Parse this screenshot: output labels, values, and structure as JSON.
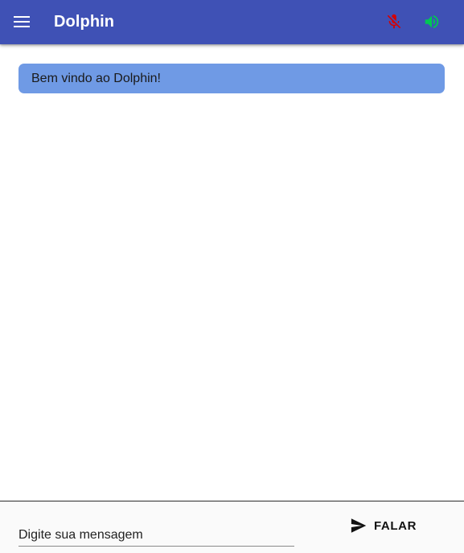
{
  "appbar": {
    "title": "Dolphin",
    "background": "#3f51b5",
    "menu_icon": "menu-icon",
    "mic_icon": "mic-off-icon",
    "mic_color": "#d50000",
    "volume_icon": "volume-up-icon",
    "volume_color": "#00c853"
  },
  "chat": {
    "messages": [
      {
        "text": "Bem vindo ao Dolphin!",
        "bubble_color": "#6f9ae5"
      }
    ]
  },
  "input_bar": {
    "placeholder": "Digite sua mensagem",
    "value": "",
    "send_icon": "send-icon",
    "speak_label": "FALAR"
  }
}
